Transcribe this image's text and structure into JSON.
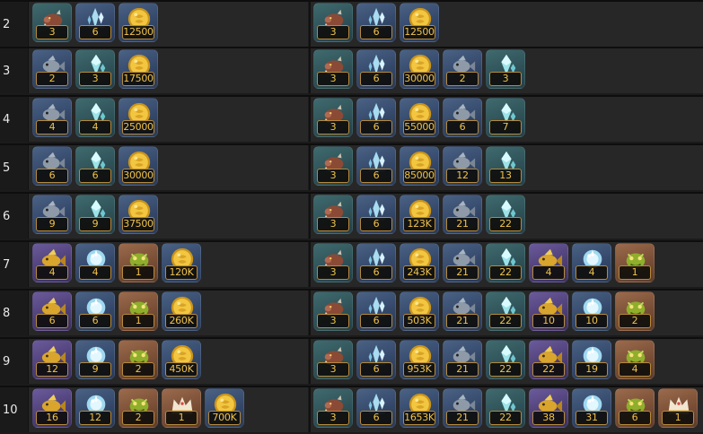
{
  "colors": {
    "qty_text": "#f0c24a",
    "qty_border": "#b58a3c",
    "row_bg": "#272727"
  },
  "rows": [
    {
      "level": "2",
      "left": [
        {
          "icon": "boar-icon",
          "qty": "3",
          "tier": "teal"
        },
        {
          "icon": "shard-icon",
          "qty": "6",
          "tier": "blue"
        },
        {
          "icon": "gold-coin-icon",
          "qty": "12500",
          "tier": "blue"
        }
      ],
      "right": [
        {
          "icon": "boar-icon",
          "qty": "3",
          "tier": "teal"
        },
        {
          "icon": "shard-icon",
          "qty": "6",
          "tier": "blue"
        },
        {
          "icon": "gold-coin-icon",
          "qty": "12500",
          "tier": "blue"
        }
      ]
    },
    {
      "level": "3",
      "left": [
        {
          "icon": "fish-icon",
          "qty": "2",
          "tier": "blue"
        },
        {
          "icon": "crystal-icon",
          "qty": "3",
          "tier": "teal"
        },
        {
          "icon": "gold-coin-icon",
          "qty": "17500",
          "tier": "blue"
        }
      ],
      "right": [
        {
          "icon": "boar-icon",
          "qty": "3",
          "tier": "teal"
        },
        {
          "icon": "shard-icon",
          "qty": "6",
          "tier": "blue"
        },
        {
          "icon": "gold-coin-icon",
          "qty": "30000",
          "tier": "blue"
        },
        {
          "icon": "fish-icon",
          "qty": "2",
          "tier": "blue"
        },
        {
          "icon": "crystal-icon",
          "qty": "3",
          "tier": "teal"
        }
      ]
    },
    {
      "level": "4",
      "left": [
        {
          "icon": "fish-icon",
          "qty": "4",
          "tier": "blue"
        },
        {
          "icon": "crystal-icon",
          "qty": "4",
          "tier": "teal"
        },
        {
          "icon": "gold-coin-icon",
          "qty": "25000",
          "tier": "blue"
        }
      ],
      "right": [
        {
          "icon": "boar-icon",
          "qty": "3",
          "tier": "teal"
        },
        {
          "icon": "shard-icon",
          "qty": "6",
          "tier": "blue"
        },
        {
          "icon": "gold-coin-icon",
          "qty": "55000",
          "tier": "blue"
        },
        {
          "icon": "fish-icon",
          "qty": "6",
          "tier": "blue"
        },
        {
          "icon": "crystal-icon",
          "qty": "7",
          "tier": "teal"
        }
      ]
    },
    {
      "level": "5",
      "left": [
        {
          "icon": "fish-icon",
          "qty": "6",
          "tier": "blue"
        },
        {
          "icon": "crystal-icon",
          "qty": "6",
          "tier": "teal"
        },
        {
          "icon": "gold-coin-icon",
          "qty": "30000",
          "tier": "blue"
        }
      ],
      "right": [
        {
          "icon": "boar-icon",
          "qty": "3",
          "tier": "teal"
        },
        {
          "icon": "shard-icon",
          "qty": "6",
          "tier": "blue"
        },
        {
          "icon": "gold-coin-icon",
          "qty": "85000",
          "tier": "blue"
        },
        {
          "icon": "fish-icon",
          "qty": "12",
          "tier": "blue"
        },
        {
          "icon": "crystal-icon",
          "qty": "13",
          "tier": "teal"
        }
      ]
    },
    {
      "level": "6",
      "left": [
        {
          "icon": "fish-icon",
          "qty": "9",
          "tier": "blue"
        },
        {
          "icon": "crystal-icon",
          "qty": "9",
          "tier": "teal"
        },
        {
          "icon": "gold-coin-icon",
          "qty": "37500",
          "tier": "blue"
        }
      ],
      "right": [
        {
          "icon": "boar-icon",
          "qty": "3",
          "tier": "teal"
        },
        {
          "icon": "shard-icon",
          "qty": "6",
          "tier": "blue"
        },
        {
          "icon": "gold-coin-icon",
          "qty": "123K",
          "tier": "blue"
        },
        {
          "icon": "fish-icon",
          "qty": "21",
          "tier": "blue"
        },
        {
          "icon": "crystal-icon",
          "qty": "22",
          "tier": "teal"
        }
      ]
    },
    {
      "level": "7",
      "left": [
        {
          "icon": "golden-fish-icon",
          "qty": "4",
          "tier": "purple"
        },
        {
          "icon": "orb-icon",
          "qty": "4",
          "tier": "blue"
        },
        {
          "icon": "green-beast-icon",
          "qty": "1",
          "tier": "orange"
        },
        {
          "icon": "gold-coin-icon",
          "qty": "120K",
          "tier": "blue"
        }
      ],
      "right": [
        {
          "icon": "boar-icon",
          "qty": "3",
          "tier": "teal"
        },
        {
          "icon": "shard-icon",
          "qty": "6",
          "tier": "blue"
        },
        {
          "icon": "gold-coin-icon",
          "qty": "243K",
          "tier": "blue"
        },
        {
          "icon": "fish-icon",
          "qty": "21",
          "tier": "blue"
        },
        {
          "icon": "crystal-icon",
          "qty": "22",
          "tier": "teal"
        },
        {
          "icon": "golden-fish-icon",
          "qty": "4",
          "tier": "purple"
        },
        {
          "icon": "orb-icon",
          "qty": "4",
          "tier": "blue"
        },
        {
          "icon": "green-beast-icon",
          "qty": "1",
          "tier": "orange"
        }
      ]
    },
    {
      "level": "8",
      "left": [
        {
          "icon": "golden-fish-icon",
          "qty": "6",
          "tier": "purple"
        },
        {
          "icon": "orb-icon",
          "qty": "6",
          "tier": "blue"
        },
        {
          "icon": "green-beast-icon",
          "qty": "1",
          "tier": "orange"
        },
        {
          "icon": "gold-coin-icon",
          "qty": "260K",
          "tier": "blue"
        }
      ],
      "right": [
        {
          "icon": "boar-icon",
          "qty": "3",
          "tier": "teal"
        },
        {
          "icon": "shard-icon",
          "qty": "6",
          "tier": "blue"
        },
        {
          "icon": "gold-coin-icon",
          "qty": "503K",
          "tier": "blue"
        },
        {
          "icon": "fish-icon",
          "qty": "21",
          "tier": "blue"
        },
        {
          "icon": "crystal-icon",
          "qty": "22",
          "tier": "teal"
        },
        {
          "icon": "golden-fish-icon",
          "qty": "10",
          "tier": "purple"
        },
        {
          "icon": "orb-icon",
          "qty": "10",
          "tier": "blue"
        },
        {
          "icon": "green-beast-icon",
          "qty": "2",
          "tier": "orange"
        }
      ]
    },
    {
      "level": "9",
      "left": [
        {
          "icon": "golden-fish-icon",
          "qty": "12",
          "tier": "purple"
        },
        {
          "icon": "orb-icon",
          "qty": "9",
          "tier": "blue"
        },
        {
          "icon": "green-beast-icon",
          "qty": "2",
          "tier": "orange"
        },
        {
          "icon": "gold-coin-icon",
          "qty": "450K",
          "tier": "blue"
        }
      ],
      "right": [
        {
          "icon": "boar-icon",
          "qty": "3",
          "tier": "teal"
        },
        {
          "icon": "shard-icon",
          "qty": "6",
          "tier": "blue"
        },
        {
          "icon": "gold-coin-icon",
          "qty": "953K",
          "tier": "blue"
        },
        {
          "icon": "fish-icon",
          "qty": "21",
          "tier": "blue"
        },
        {
          "icon": "crystal-icon",
          "qty": "22",
          "tier": "teal"
        },
        {
          "icon": "golden-fish-icon",
          "qty": "22",
          "tier": "purple"
        },
        {
          "icon": "orb-icon",
          "qty": "19",
          "tier": "blue"
        },
        {
          "icon": "green-beast-icon",
          "qty": "4",
          "tier": "orange"
        }
      ]
    },
    {
      "level": "10",
      "left": [
        {
          "icon": "golden-fish-icon",
          "qty": "16",
          "tier": "purple"
        },
        {
          "icon": "orb-icon",
          "qty": "12",
          "tier": "blue"
        },
        {
          "icon": "green-beast-icon",
          "qty": "2",
          "tier": "orange"
        },
        {
          "icon": "crown-icon",
          "qty": "1",
          "tier": "orange"
        },
        {
          "icon": "gold-coin-icon",
          "qty": "700K",
          "tier": "blue"
        }
      ],
      "right": [
        {
          "icon": "boar-icon",
          "qty": "3",
          "tier": "teal"
        },
        {
          "icon": "shard-icon",
          "qty": "6",
          "tier": "blue"
        },
        {
          "icon": "gold-coin-icon",
          "qty": "1653K",
          "tier": "blue"
        },
        {
          "icon": "fish-icon",
          "qty": "21",
          "tier": "blue"
        },
        {
          "icon": "crystal-icon",
          "qty": "22",
          "tier": "teal"
        },
        {
          "icon": "golden-fish-icon",
          "qty": "38",
          "tier": "purple"
        },
        {
          "icon": "orb-icon",
          "qty": "31",
          "tier": "blue"
        },
        {
          "icon": "green-beast-icon",
          "qty": "6",
          "tier": "orange"
        },
        {
          "icon": "crown-icon",
          "qty": "1",
          "tier": "orange"
        }
      ]
    }
  ]
}
